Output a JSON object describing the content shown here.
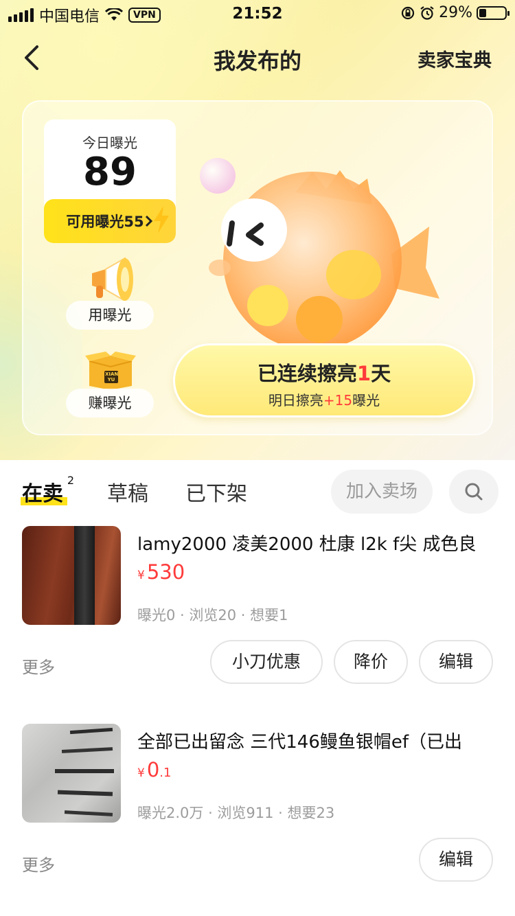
{
  "status_bar": {
    "carrier": "中国电信",
    "vpn": "VPN",
    "time": "21:52",
    "battery": "29%"
  },
  "nav": {
    "title": "我发布的",
    "right_link": "卖家宝典"
  },
  "exposure": {
    "today_label": "今日曝光",
    "today_value": "89",
    "available_label": "可用曝光55",
    "use_label": "用曝光",
    "earn_label": "赚曝光",
    "box_text": "XIAN YU"
  },
  "streak": {
    "prefix": "已连续擦亮",
    "days": "1",
    "suffix": "天",
    "tomorrow_prefix": "明日擦亮",
    "tomorrow_bonus": "+15",
    "tomorrow_suffix": "曝光"
  },
  "tabs": {
    "on_sale": "在卖",
    "on_sale_count": "2",
    "drafts": "草稿",
    "removed": "已下架",
    "join_market": "加入卖场"
  },
  "items": [
    {
      "title": "lamy2000 凌美2000 杜康 l2k f尖 成色良",
      "currency": "¥",
      "price_int": "530",
      "price_dec": "",
      "stats": "曝光0 · 浏览20 · 想要1",
      "more": "更多",
      "buttons": [
        "小刀优惠",
        "降价",
        "编辑"
      ]
    },
    {
      "title": "全部已出留念 三代146鳗鱼银帽ef（已出",
      "currency": "¥",
      "price_int": "0",
      "price_dec": ".1",
      "stats": "曝光2.0万 · 浏览911 · 想要23",
      "more": "更多",
      "buttons": [
        "编辑"
      ]
    }
  ],
  "colors": {
    "accent_yellow": "#ffe21a",
    "price_red": "#ff3a3a"
  }
}
